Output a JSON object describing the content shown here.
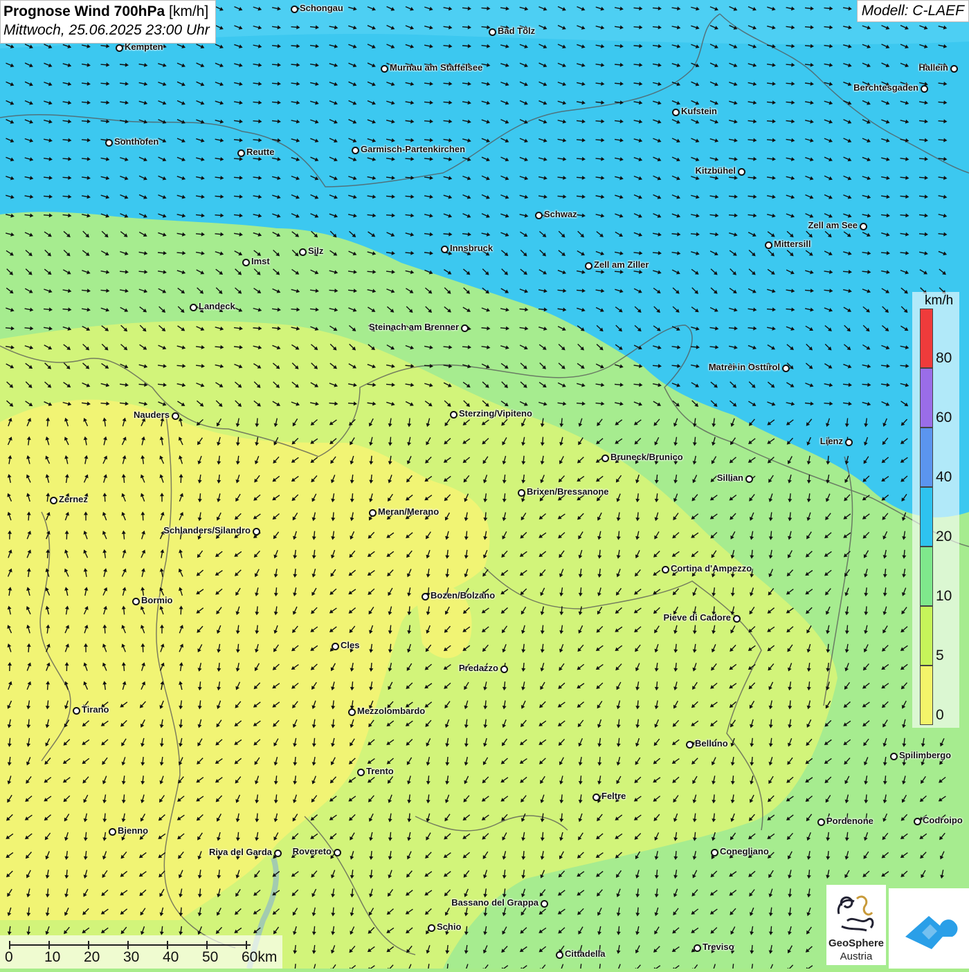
{
  "title": {
    "main": "Prognose Wind 700hPa",
    "unit": "[km/h]",
    "datetime": "Mittwoch, 25.06.2025 23:00 Uhr"
  },
  "model": "Modell: C-LAEF",
  "legend": {
    "unit": "km/h",
    "labels": [
      "80",
      "60",
      "40",
      "20",
      "10",
      "5",
      "0"
    ],
    "colors": [
      "#ef3b3b",
      "#9a6de8",
      "#5b95ef",
      "#2ec3ef",
      "#7fe88c",
      "#c7f55a",
      "#f4f56a"
    ]
  },
  "scalebar": {
    "labels": [
      "0",
      "10",
      "20",
      "30",
      "40",
      "50",
      "60km"
    ]
  },
  "cities": [
    {
      "name": "Schongau"
    },
    {
      "name": "Bad Tölz"
    },
    {
      "name": "Kempten"
    },
    {
      "name": "Murnau am Staffelsee"
    },
    {
      "name": "Hallein"
    },
    {
      "name": "Berchtesgaden"
    },
    {
      "name": "Kufstein"
    },
    {
      "name": "Sonthofen"
    },
    {
      "name": "Reutte"
    },
    {
      "name": "Garmisch-Partenkirchen"
    },
    {
      "name": "Kitzbühel"
    },
    {
      "name": "Schwaz"
    },
    {
      "name": "Zell am See"
    },
    {
      "name": "Innsbruck"
    },
    {
      "name": "Mittersill"
    },
    {
      "name": "Silz"
    },
    {
      "name": "Imst"
    },
    {
      "name": "Zell am Ziller"
    },
    {
      "name": "Landeck"
    },
    {
      "name": "Steinach am Brenner"
    },
    {
      "name": "Matrei in Osttirol"
    },
    {
      "name": "Nauders"
    },
    {
      "name": "Sterzing/Vipiteno"
    },
    {
      "name": "Lienz"
    },
    {
      "name": "Bruneck/Brunico"
    },
    {
      "name": "Sillian"
    },
    {
      "name": "Zernez"
    },
    {
      "name": "Brixen/Bressanone"
    },
    {
      "name": "Meran/Merano"
    },
    {
      "name": "Schlanders/Silandro"
    },
    {
      "name": "Cortina d'Ampezzo"
    },
    {
      "name": "Bozen/Bolzano"
    },
    {
      "name": "Bormio"
    },
    {
      "name": "Pieve di Cadore"
    },
    {
      "name": "Cles"
    },
    {
      "name": "Predazzo"
    },
    {
      "name": "Tirano"
    },
    {
      "name": "Mezzolombardo"
    },
    {
      "name": "Belluno"
    },
    {
      "name": "Spilimbergo"
    },
    {
      "name": "Trento"
    },
    {
      "name": "Feltre"
    },
    {
      "name": "Pordenone"
    },
    {
      "name": "Codroipo"
    },
    {
      "name": "Bienno"
    },
    {
      "name": "Riva del Garda"
    },
    {
      "name": "Rovereto"
    },
    {
      "name": "Conegliano"
    },
    {
      "name": "Bassano del Grappa"
    },
    {
      "name": "Schio"
    },
    {
      "name": "Treviso"
    },
    {
      "name": "Cittadella"
    }
  ],
  "logo": {
    "name_line1": "GeoSphere",
    "name_line2": "Austria"
  }
}
